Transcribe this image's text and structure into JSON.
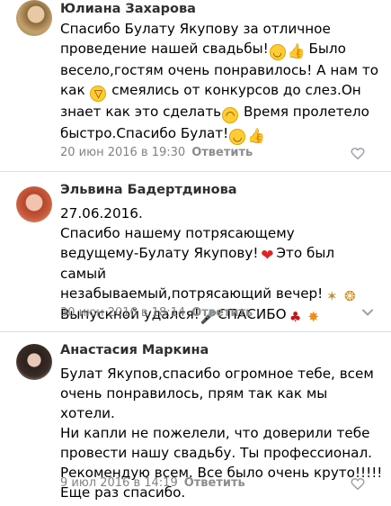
{
  "comments": [
    {
      "author": "Юлиана Захарова",
      "lines": [
        "Спасибо Булату Якупову за отличное",
        "проведение нашей свадьбы!",
        " Было",
        "весело,гостям очень понравилось! А нам то",
        "как ",
        " смеялись от конкурсов до слез.Он",
        "знает как это сделать",
        " Время пролетело",
        "быстро.Спасибо Булат!"
      ],
      "date": "20 июн 2016 в 19:30",
      "reply": "Ответить",
      "icons": [
        "smile-icon",
        "thumbs-up-icon",
        "laughing-icon",
        "wink-icon",
        "smile-icon",
        "thumbs-up-icon",
        "like-heart-icon"
      ]
    },
    {
      "author": "Эльвина Бадертдинова",
      "lines": [
        "27.06.2016.",
        "Спасибо нашему потрясающему",
        "ведущему-Булату Якупову!",
        "Это был самый",
        "незабываемый,потрясающий вечер!",
        "Выпускной удался!",
        "СПАСИБО"
      ],
      "date": "30 июн 2016 в 18:14",
      "reply": "Ответить",
      "icons": [
        "heart-icon",
        "party-popper-icon",
        "confetti-icon",
        "microphone-icon",
        "dancer-icon",
        "collision-icon",
        "chevron-down-icon"
      ]
    },
    {
      "author": "Анастасия Маркина",
      "text": "Булат Якупов,спасибо огромное тебе, всем\nочень понравилось, прям так как мы хотели.\nНи капли не пожелели, что доверили тебе\nпровести нашу свадьбу. Ты профессионал.\nРекомендую всем. Все было очень круто!!!!!\nЕще раз спасибо.",
      "date": "9 июл 2016 в 14:19",
      "reply": "Ответить",
      "icons": [
        "like-heart-icon"
      ]
    }
  ]
}
